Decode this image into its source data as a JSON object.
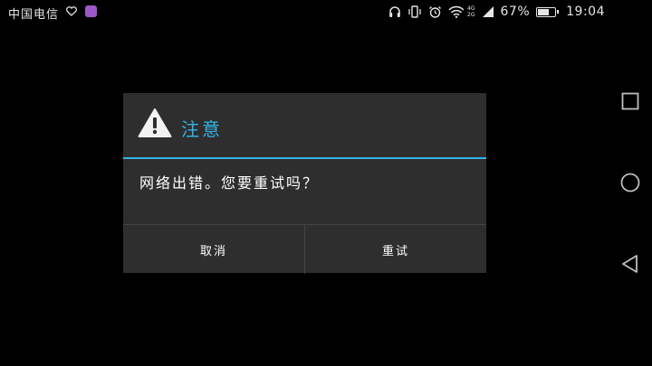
{
  "status_bar": {
    "carrier": "中国电信",
    "network_type_top": "4G",
    "network_type_bottom": "2G",
    "battery_percent_text": "67%",
    "battery_level": 0.67,
    "time": "19:04",
    "icons": [
      "heart-notification-icon",
      "app-notification-icon",
      "headphones-icon",
      "vibrate-icon",
      "alarm-icon",
      "wifi-icon",
      "signal-icon",
      "battery-icon"
    ]
  },
  "dialog": {
    "title": "注意",
    "icon": "warning-icon",
    "message": "网络出错。您要重试吗？",
    "buttons": {
      "cancel_label": "取消",
      "retry_label": "重试"
    }
  },
  "nav_bar": {
    "icons": [
      "recent-apps-icon",
      "home-icon",
      "back-icon"
    ]
  },
  "colors": {
    "background": "#000000",
    "dialog_background": "#2e2e2e",
    "accent": "#33b5e5",
    "notification_app": "#9b59c6",
    "nav_icon": "#bfbfbf",
    "text": "#ffffff"
  }
}
